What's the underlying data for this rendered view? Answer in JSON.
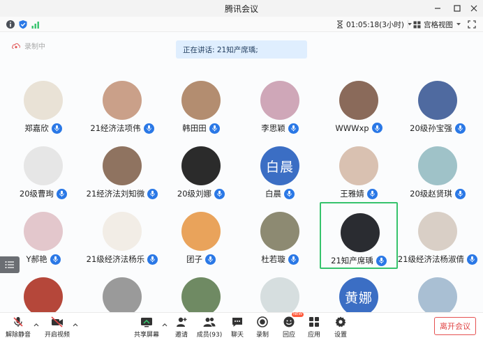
{
  "window": {
    "title": "腾讯会议"
  },
  "infobar": {
    "duration": "01:05:18(3小时)",
    "view_label": "宫格视图"
  },
  "stage": {
    "recording_label": "录制中",
    "speaking_text": "正在讲话: 21知产席瑀;"
  },
  "participants": [
    {
      "name": "郑嘉欣",
      "avatar_text": "",
      "color": "#e9e2d6"
    },
    {
      "name": "21经济法项伟",
      "avatar_text": "",
      "color": "#caa089"
    },
    {
      "name": "韩田田",
      "avatar_text": "",
      "color": "#b38d70"
    },
    {
      "name": "李思颖",
      "avatar_text": "",
      "color": "#cfa7b8"
    },
    {
      "name": "WWWxp",
      "avatar_text": "",
      "color": "#8a6a5a"
    },
    {
      "name": "20级孙宝强",
      "avatar_text": "",
      "color": "#4f6aa0"
    },
    {
      "name": "20级曹珣",
      "avatar_text": "",
      "color": "#e6e6e6"
    },
    {
      "name": "21经济法刘知微",
      "avatar_text": "",
      "color": "#8f7360"
    },
    {
      "name": "20级刘娜",
      "avatar_text": "",
      "color": "#2b2b2b"
    },
    {
      "name": "白晨",
      "avatar_text": "白晨",
      "color": "#3b6ec4"
    },
    {
      "name": "王雅婧",
      "avatar_text": "",
      "color": "#d9c1b1"
    },
    {
      "name": "20级赵贤琪",
      "avatar_text": "",
      "color": "#9fc2c8"
    },
    {
      "name": "Y郝艳",
      "avatar_text": "",
      "color": "#e3c7cc"
    },
    {
      "name": "21级经济法杨乐",
      "avatar_text": "",
      "color": "#f2ede6"
    },
    {
      "name": "团子",
      "avatar_text": "",
      "color": "#e9a35b"
    },
    {
      "name": "杜若璇",
      "avatar_text": "",
      "color": "#8d8a72"
    },
    {
      "name": "21知产席瑀",
      "avatar_text": "",
      "color": "#2a2c31"
    },
    {
      "name": "21级经济法杨淑倩",
      "avatar_text": "",
      "color": "#d9cfc6"
    },
    {
      "name": "",
      "avatar_text": "",
      "color": "#b5473a"
    },
    {
      "name": "",
      "avatar_text": "",
      "color": "#9a9a9a"
    },
    {
      "name": "",
      "avatar_text": "",
      "color": "#6f8a63"
    },
    {
      "name": "",
      "avatar_text": "",
      "color": "#d6dedf"
    },
    {
      "name": "",
      "avatar_text": "黄娜",
      "color": "#3b6ec4"
    },
    {
      "name": "",
      "avatar_text": "",
      "color": "#a9bfd3"
    }
  ],
  "active_speaker": "21知产席瑀",
  "toolbar": {
    "mute_label": "解除静音",
    "video_label": "开启视频",
    "share_label": "共享屏幕",
    "invite_label": "邀请",
    "members_label": "成员(93)",
    "chat_label": "聊天",
    "record_label": "录制",
    "react_label": "回应",
    "apps_label": "应用",
    "settings_label": "设置",
    "leave_label": "离开会议",
    "new_badge": "NEW"
  },
  "colors": {
    "accent": "#2a78e6",
    "active_border": "#36c36c",
    "leave": "#e04545",
    "signal": "#36c36c"
  }
}
